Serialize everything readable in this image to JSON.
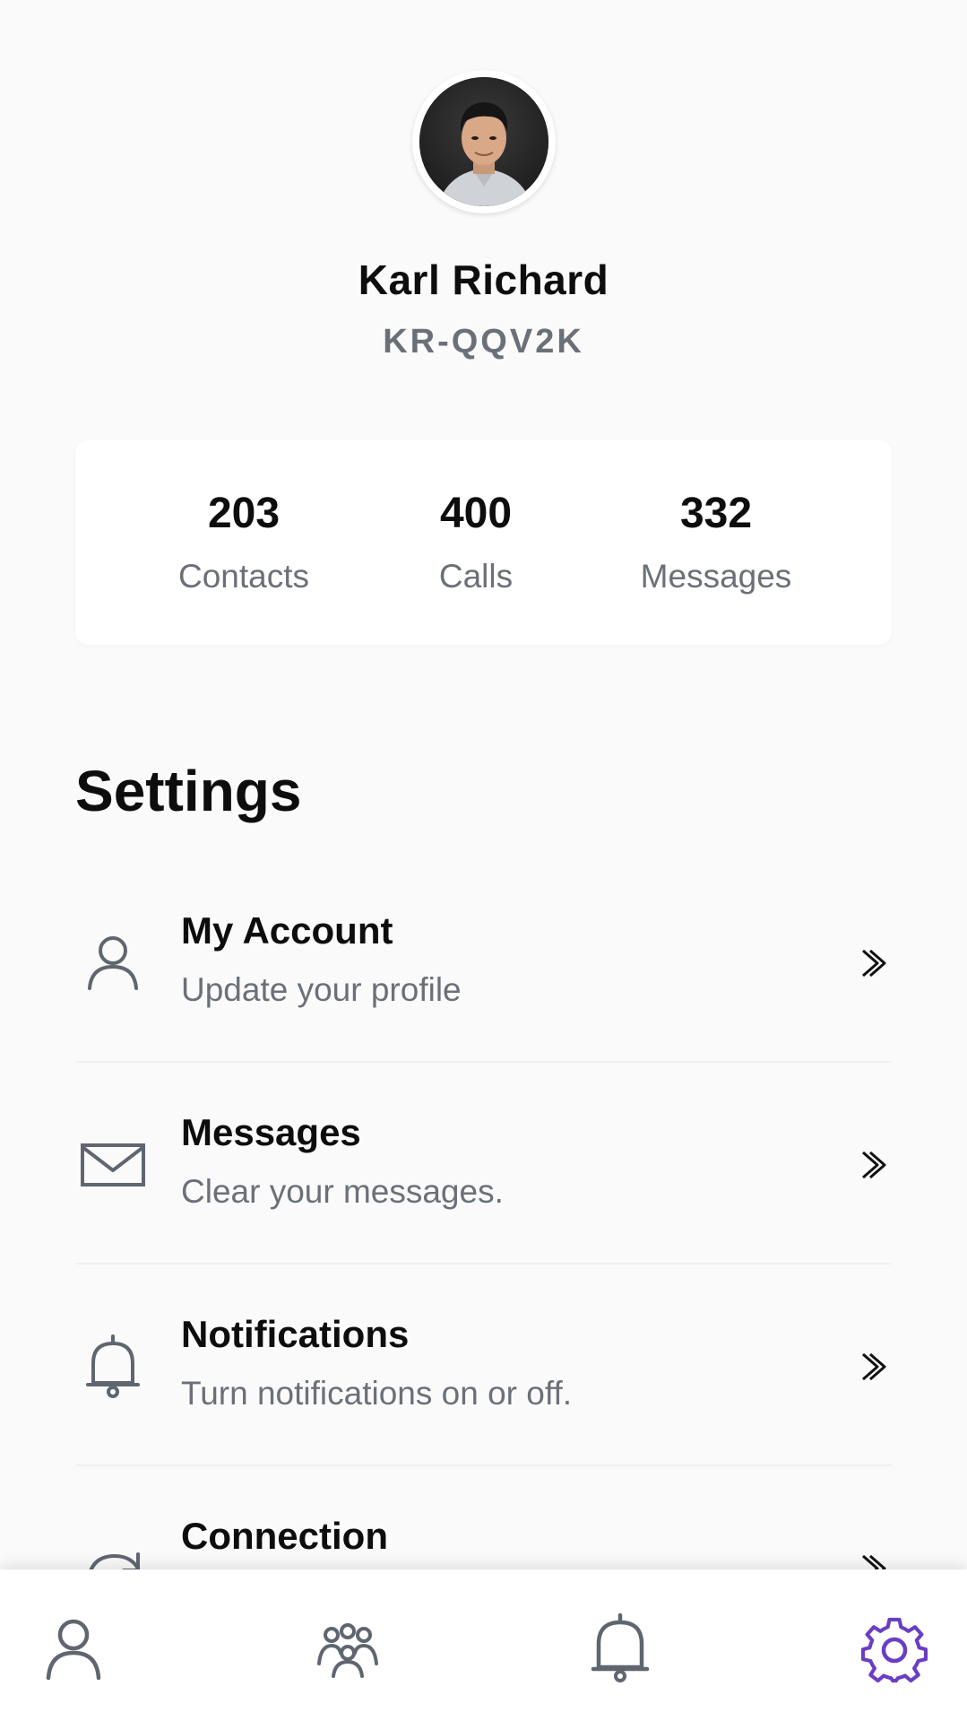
{
  "profile": {
    "name": "Karl Richard",
    "id": "KR-QQV2K",
    "avatar_icon": "user-photo"
  },
  "stats": [
    {
      "value": "203",
      "label": "Contacts"
    },
    {
      "value": "400",
      "label": "Calls"
    },
    {
      "value": "332",
      "label": "Messages"
    }
  ],
  "settings": {
    "title": "Settings",
    "items": [
      {
        "title": "My Account",
        "subtitle": "Update your profile",
        "icon": "user-icon"
      },
      {
        "title": "Messages",
        "subtitle": "Clear your messages.",
        "icon": "envelope-icon"
      },
      {
        "title": "Notifications",
        "subtitle": "Turn notifications on or off.",
        "icon": "bell-icon"
      },
      {
        "title": "Connection",
        "subtitle": "",
        "icon": "refresh-icon"
      }
    ]
  },
  "bottom_nav": {
    "tabs": [
      {
        "icon": "user-icon",
        "active": false
      },
      {
        "icon": "group-icon",
        "active": false
      },
      {
        "icon": "bell-icon",
        "active": false
      },
      {
        "icon": "gear-icon",
        "active": true
      }
    ],
    "active_color": "#6a3ec2",
    "inactive_color": "#5f6670"
  },
  "colors": {
    "background": "#fafafa",
    "text_primary": "#0d0d0d",
    "text_secondary": "#6b7078",
    "accent": "#6a3ec2"
  }
}
